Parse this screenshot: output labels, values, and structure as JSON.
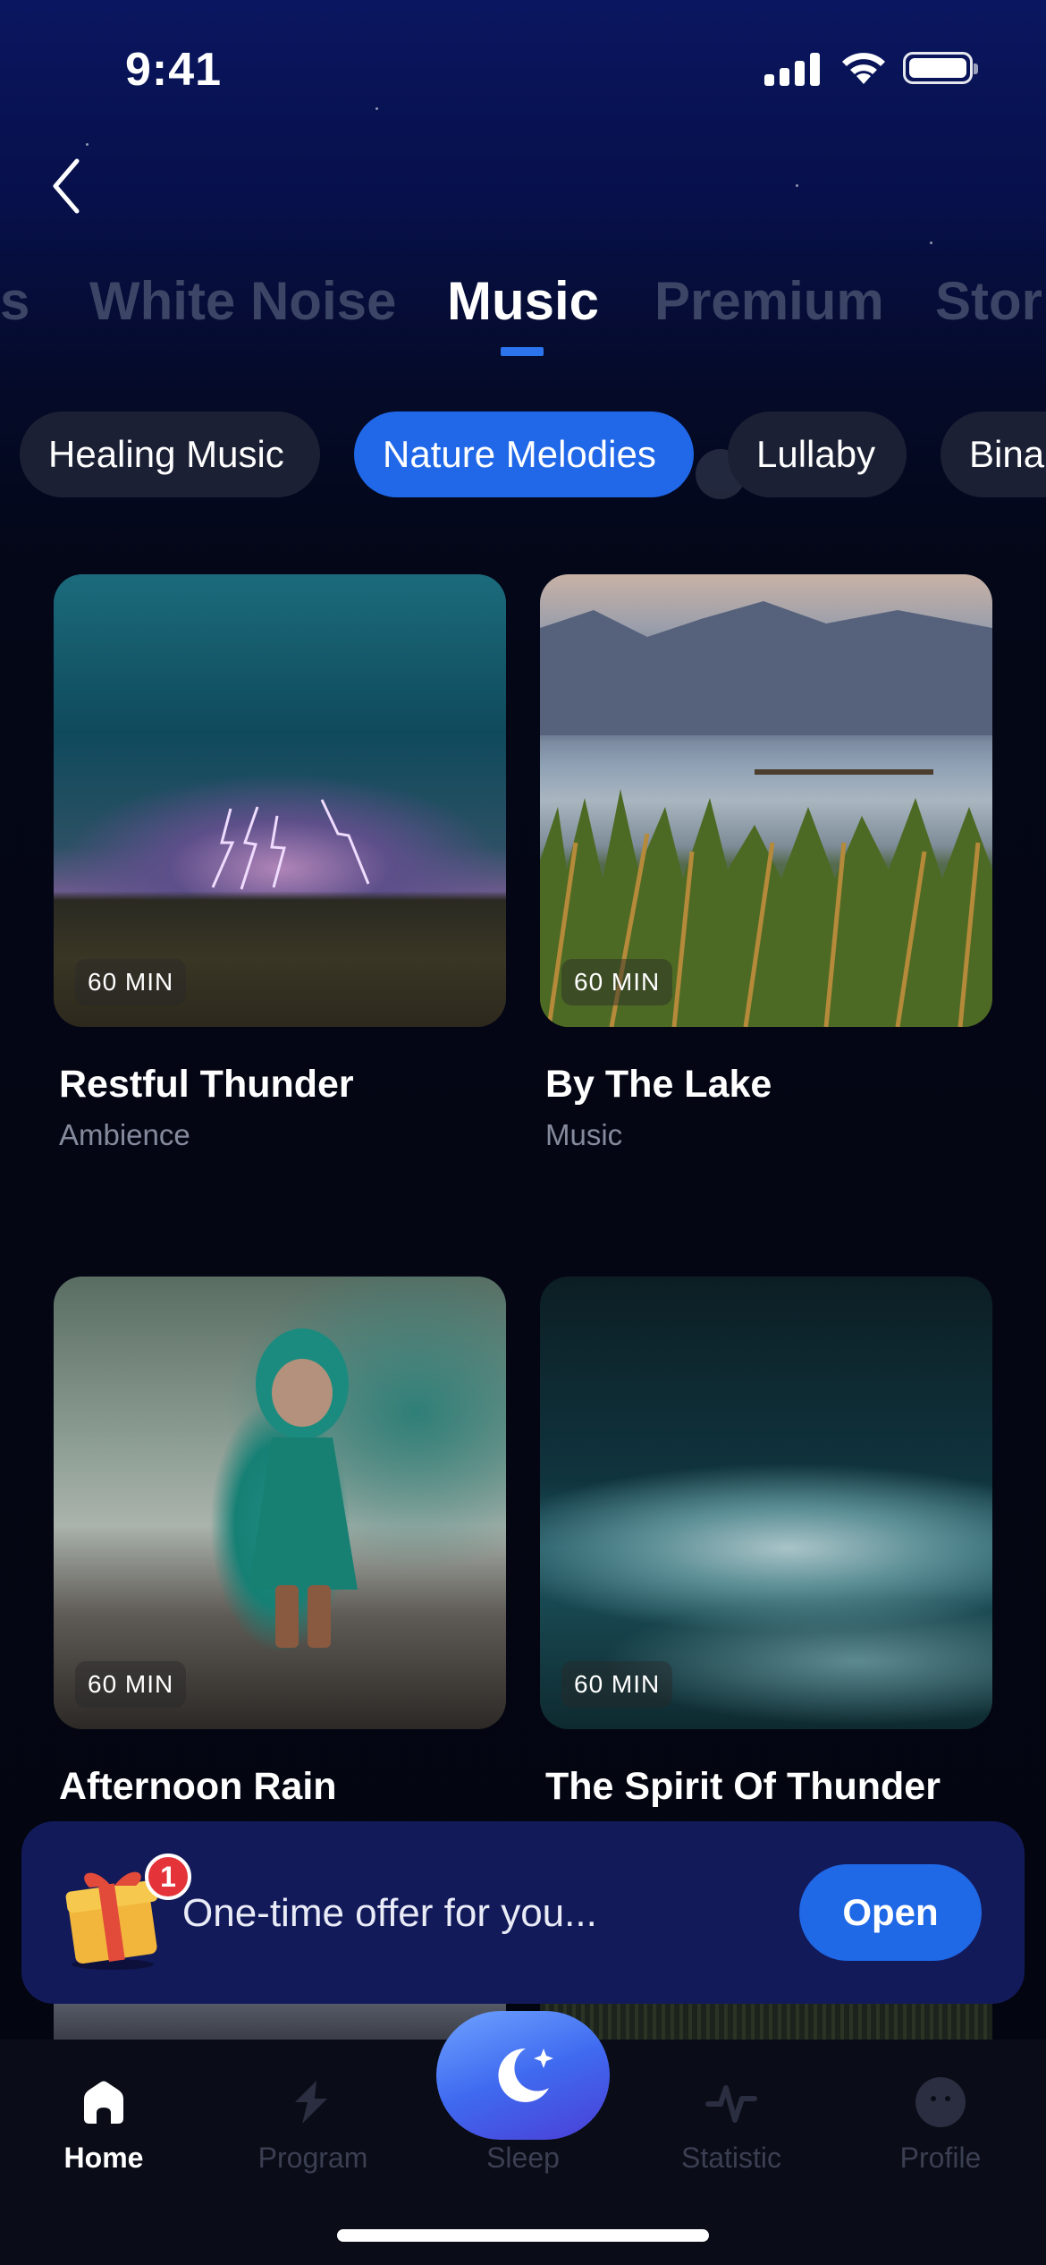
{
  "status_bar": {
    "time": "9:41"
  },
  "category_tabs": [
    "s",
    "White Noise",
    "Music",
    "Premium",
    "Stor"
  ],
  "active_category": "Music",
  "chips": [
    "Healing Music",
    "Nature Melodies",
    "Lullaby",
    "Bina"
  ],
  "active_chip": "Nature Melodies",
  "cards": [
    {
      "title": "Restful Thunder",
      "subtitle": "Ambience",
      "duration": "60 MIN"
    },
    {
      "title": "By The Lake",
      "subtitle": "Music",
      "duration": "60 MIN"
    },
    {
      "title": "Afternoon Rain",
      "subtitle": "",
      "duration": "60 MIN"
    },
    {
      "title": "The Spirit Of Thunder",
      "subtitle": "",
      "duration": "60 MIN"
    }
  ],
  "offer": {
    "text": "One-time offer for you...",
    "button_label": "Open",
    "badge_count": "1"
  },
  "tab_bar": {
    "items": [
      {
        "label": "Home",
        "icon": "home-icon"
      },
      {
        "label": "Program",
        "icon": "program-icon"
      },
      {
        "label": "Sleep",
        "icon": "moon-icon"
      },
      {
        "label": "Statistic",
        "icon": "statistic-icon"
      },
      {
        "label": "Profile",
        "icon": "profile-icon"
      }
    ],
    "active": "Home"
  },
  "colors": {
    "accent": "#2068e8",
    "banner": "#131a5a",
    "badge": "#e5333a"
  }
}
